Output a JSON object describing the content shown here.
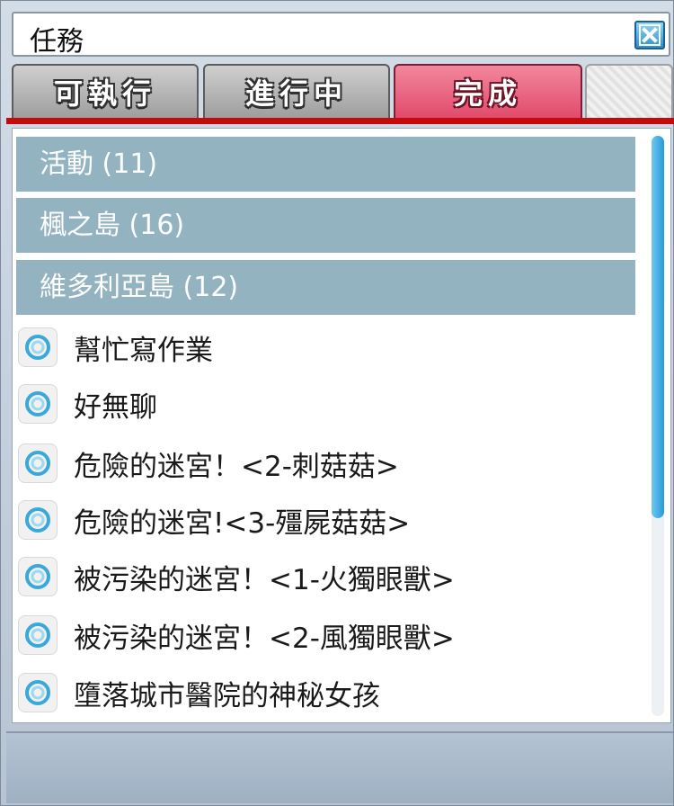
{
  "window": {
    "title": "任務",
    "close_icon": "close-icon"
  },
  "tabs": [
    {
      "label": "可執行",
      "active": false
    },
    {
      "label": "進行中",
      "active": false
    },
    {
      "label": "完成",
      "active": true
    },
    {
      "label": "",
      "active": false
    }
  ],
  "categories": [
    {
      "label": "活動 (11)"
    },
    {
      "label": "楓之島 (16)"
    },
    {
      "label": "維多利亞島 (12)"
    }
  ],
  "items": [
    {
      "label": "幫忙寫作業"
    },
    {
      "label": "好無聊"
    },
    {
      "label": "危險的迷宮！<2-刺菇菇>"
    },
    {
      "label": "危險的迷宮!<3-殭屍菇菇>"
    },
    {
      "label": "被污染的迷宮！<1-火獨眼獸>"
    },
    {
      "label": "被污染的迷宮！<2-風獨眼獸>"
    },
    {
      "label": "墮落城市醫院的神秘女孩"
    }
  ],
  "colors": {
    "active_tab": "#e14b6c",
    "category_bg": "#93b3c1",
    "accent_rule": "#c40a0a",
    "scroll_thumb": "#2a9ad6"
  }
}
